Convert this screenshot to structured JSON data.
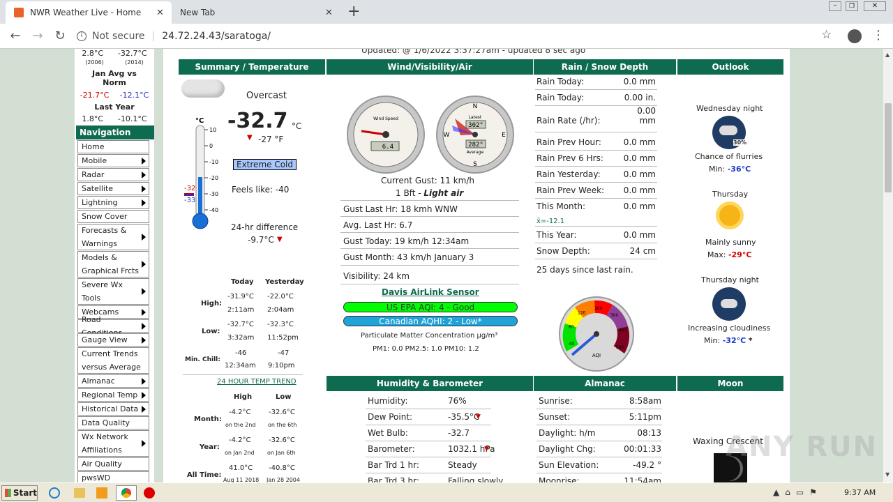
{
  "browser": {
    "tabs": [
      {
        "title": "NWR Weather Live - Home",
        "active": true
      },
      {
        "title": "New Tab",
        "active": false
      }
    ],
    "security": "Not secure",
    "url": "24.72.24.43/saratoga/"
  },
  "left": {
    "records_top": [
      "2.8°C",
      "-32.7°C",
      "(2006)",
      "(2014)"
    ],
    "jan_avg_title": "Jan Avg vs Norm",
    "jan_avg_values": [
      "-21.7°C",
      "-12.1°C"
    ],
    "last_year_title": "Last Year",
    "last_year_values": [
      "1.8°C",
      "-10.1°C"
    ],
    "nav_title": "Navigation",
    "nav_items": [
      {
        "label": "Home",
        "arrow": false
      },
      {
        "label": "Mobile",
        "arrow": true
      },
      {
        "label": "Radar",
        "arrow": true
      },
      {
        "label": "Satellite",
        "arrow": true
      },
      {
        "label": "Lightning",
        "arrow": true
      },
      {
        "label": "Snow Cover",
        "arrow": false
      },
      {
        "label": "Forecasts & Warnings",
        "arrow": true
      },
      {
        "label": "Models & Graphical Frcts",
        "arrow": true
      },
      {
        "label": "Severe Wx Tools",
        "arrow": true
      },
      {
        "label": "Webcams",
        "arrow": true
      },
      {
        "label": "Road Conditions",
        "arrow": true
      },
      {
        "label": "Gauge View",
        "arrow": true
      },
      {
        "label": "Current Trends versus Average",
        "arrow": false
      },
      {
        "label": "Almanac",
        "arrow": true
      },
      {
        "label": "Regional Temp",
        "arrow": true
      },
      {
        "label": "Historical Data",
        "arrow": true
      },
      {
        "label": "Data Quality",
        "arrow": false
      },
      {
        "label": "Wx Network Affiliations",
        "arrow": true
      },
      {
        "label": "Air Quality",
        "arrow": false
      },
      {
        "label": "pwsWD",
        "arrow": false
      }
    ]
  },
  "updated": "Updated: @ 1/6/2022 3:37:27am - updated 8 sec ago",
  "headers": {
    "summary": "Summary / Temperature",
    "wind": "Wind/Visibility/Air",
    "rain": "Rain / Snow Depth",
    "outlook": "Outlook",
    "humidity": "Humidity & Barometer",
    "almanac": "Almanac",
    "moon": "Moon"
  },
  "summary": {
    "condition": "Overcast",
    "temp": "-32.7",
    "temp_unit": "°C",
    "temp_f": "-27 °F",
    "badge": "Extreme Cold",
    "feels": "Feels like: -40",
    "diff_title": "24-hr difference",
    "diff": "-9.7°C",
    "scale": [
      "°C",
      "10",
      "0",
      "-10",
      "-20",
      "-30",
      "-40"
    ],
    "markers": [
      "-32",
      "-33"
    ],
    "table_headers": [
      "Today",
      "Yesterday"
    ],
    "high_label": "High:",
    "high": [
      "-31.9°C",
      "-22.0°C",
      "2:11am",
      "2:04am"
    ],
    "low_label": "Low:",
    "low": [
      "-32.7°C",
      "-32.3°C",
      "3:32am",
      "11:52pm"
    ],
    "chill_label": "Min. Chill:",
    "chill": [
      "-46",
      "-47",
      "12:34am",
      "9:10pm"
    ],
    "trend_link": "24 HOUR TEMP TREND",
    "rec_headers": [
      "High",
      "Low"
    ],
    "month_label": "Month:",
    "month": [
      "-4.2°C",
      "-32.6°C",
      "on the 2nd",
      "on the 6th"
    ],
    "year_label": "Year:",
    "year": [
      "-4.2°C",
      "-32.6°C",
      "on Jan 2nd",
      "on Jan 6th"
    ],
    "alltime_label": "All Time:",
    "alltime": [
      "41.0°C",
      "-40.8°C",
      "Aug 11 2018",
      "Jan 28 2004"
    ],
    "thermo_level": 0.12
  },
  "wind": {
    "gauge_speed": "6.4",
    "gauge_speed_title": "Wind Speed",
    "gauge_dir_top": "302°",
    "gauge_dir_bottom": "282°",
    "gauge_dir_title": "Latest",
    "gauge_dir_sub": "Average",
    "gust": "Current Gust: 11 km/h",
    "bft": "1 Bft - ",
    "bft_desc": "Light air",
    "rows": [
      "Gust Last Hr: 18 kmh WNW",
      "Avg. Last Hr: 6.7",
      "Gust Today: 19 km/h 12:34am",
      "Gust Month: 43 km/h January 3"
    ],
    "visibility": "Visibility: 24 km",
    "sensor_link": "Davis AirLink Sensor",
    "aqi_us": "US EPA AQI: 4 - Good",
    "aqi_ca": "Canadian AQHI: 2 - Low*",
    "pm_title": "Particulate Matter Concentration µg/m³",
    "pm": "PM1: 0.0  PM2.5: 1.0  PM10: 1.2",
    "aqi_gauge_label": "AQI",
    "aqi_ticks": [
      "40",
      "80",
      "120",
      "200",
      "300",
      "400",
      "500"
    ],
    "aqi_value": 4
  },
  "rain": {
    "rows": [
      {
        "label": "Rain Today:",
        "value": "0.0 mm"
      },
      {
        "label": "Rain Today:",
        "value": "0.00  in."
      },
      {
        "label": "Rain Rate (/hr):",
        "value": "0.00 mm"
      },
      {
        "label": "Rain Prev Hour:",
        "value": "0.0 mm"
      },
      {
        "label": "Rain Prev 6 Hrs:",
        "value": "0.0 mm"
      },
      {
        "label": "Rain Yesterday:",
        "value": "0.0 mm"
      },
      {
        "label": "Rain Prev Week:",
        "value": "0.0 mm"
      },
      {
        "label": "This Month:",
        "value": "0.0 mm"
      },
      {
        "label": "This Year:",
        "value": "0.0 mm"
      },
      {
        "label": "Snow Depth:",
        "value": "24 cm"
      }
    ],
    "month_avg": "x̄=-12.1",
    "since": "25 days since last rain."
  },
  "outlook": [
    {
      "period": "Wednesday night",
      "desc": "Chance of flurries",
      "minmax": "Min: ",
      "temp": "-36°C",
      "pop": "30%"
    },
    {
      "period": "Thursday",
      "desc": "Mainly sunny",
      "minmax": "Max: ",
      "temp": "-29°C",
      "pop": ""
    },
    {
      "period": "Thursday night",
      "desc": "Increasing cloudiness",
      "minmax": "Min: ",
      "temp": "-32°C",
      "pop": "*"
    }
  ],
  "humidity": {
    "rows": [
      {
        "label": "Humidity:",
        "value": "76%",
        "arrow": ""
      },
      {
        "label": "Dew Point:",
        "value": "-35.5°C",
        "arrow": "down"
      },
      {
        "label": "Wet Bulb:",
        "value": "-32.7",
        "arrow": ""
      },
      {
        "label": "Barometer:",
        "value": "1032.1 hPa",
        "arrow": "down"
      },
      {
        "label": "Bar Trd 1 hr:",
        "value": "Steady",
        "arrow": ""
      },
      {
        "label": "Bar Trd 3 hr:",
        "value": "Falling slowly",
        "arrow": ""
      }
    ]
  },
  "almanac": {
    "rows": [
      {
        "label": "Sunrise:",
        "value": "8:58am"
      },
      {
        "label": "Sunset:",
        "value": "5:11pm"
      },
      {
        "label": "Daylight: h/m",
        "value": "08:13"
      },
      {
        "label": "Daylight Chg:",
        "value": "00:01:33"
      },
      {
        "label": "Sun Elevation:",
        "value": "-49.2 °"
      },
      {
        "label": "Moonrise:",
        "value": "11:54am"
      }
    ]
  },
  "moon": {
    "phase": "Waxing Crescent"
  },
  "taskbar": {
    "start": "Start",
    "clock": "9:37 AM"
  },
  "watermark": "ANY RUN"
}
